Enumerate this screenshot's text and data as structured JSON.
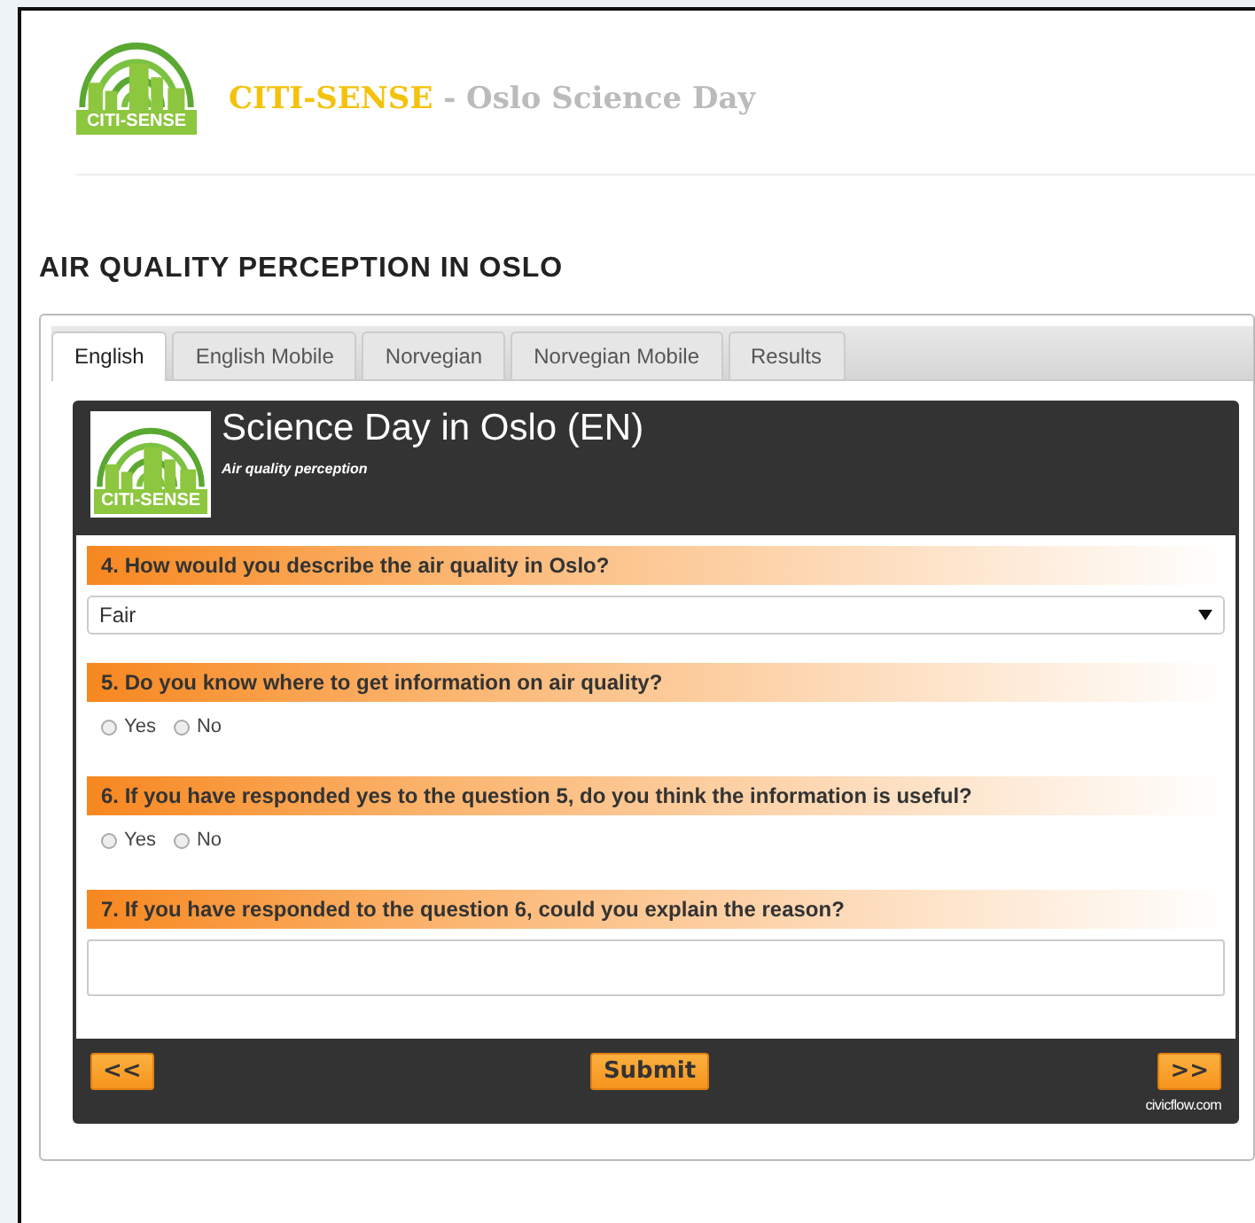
{
  "site_header": {
    "logo_text": "CITI-SENSE",
    "brand": "CITI-SENSE",
    "title": " - Oslo Science Day"
  },
  "page_heading": "AIR QUALITY PERCEPTION IN OSLO",
  "tabs": [
    {
      "label": "English",
      "selected": true
    },
    {
      "label": "English Mobile",
      "selected": false
    },
    {
      "label": "Norvegian",
      "selected": false
    },
    {
      "label": "Norvegian Mobile",
      "selected": false
    },
    {
      "label": "Results",
      "selected": false
    }
  ],
  "survey": {
    "logo_text": "CITI-SENSE",
    "title": "Science Day in Oslo (EN)",
    "subtitle": "Air quality perception",
    "questions": [
      {
        "kind": "dropdown",
        "label": "4. How would you describe the air quality in Oslo?",
        "value": "Fair"
      },
      {
        "kind": "radio",
        "label": "5. Do you know where to get information on air quality?",
        "options": [
          {
            "label": "Yes",
            "selected": false
          },
          {
            "label": "No",
            "selected": false
          }
        ]
      },
      {
        "kind": "radio",
        "label": "6. If you have responded yes to the question 5, do you think the information is useful?",
        "options": [
          {
            "label": "Yes",
            "selected": false
          },
          {
            "label": "No",
            "selected": false
          }
        ]
      },
      {
        "kind": "textarea",
        "label": "7. If you have responded to the question 6, could you explain the reason?"
      }
    ],
    "footer": {
      "prev": "<<",
      "submit": "Submit",
      "next": ">>",
      "credit": "civicflow.com"
    }
  }
}
